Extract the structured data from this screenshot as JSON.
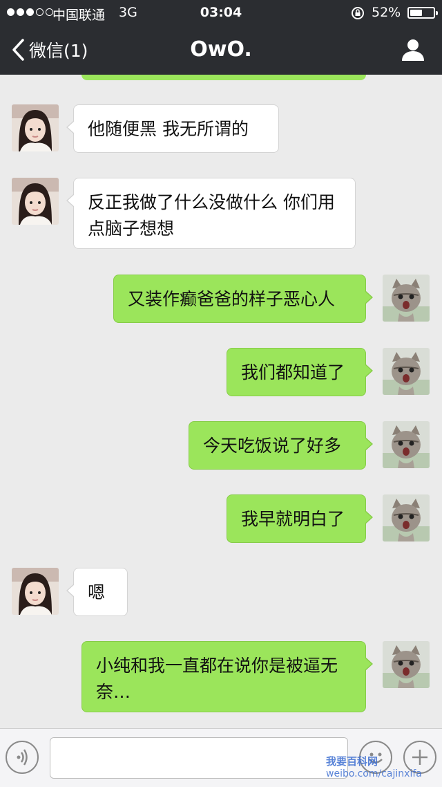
{
  "status_bar": {
    "carrier": "中国联通",
    "network": "3G",
    "time": "03:04",
    "battery": "52%",
    "battery_level": 0.52
  },
  "nav": {
    "back_label": "微信(1)",
    "title": "OwO.",
    "icons": {
      "back": "chevron-left-icon",
      "profile": "person-icon"
    }
  },
  "messages": [
    {
      "side": "in",
      "text": "他随便黑 我无所谓的",
      "avatar": "girl-avatar"
    },
    {
      "side": "in",
      "text": "反正我做了什么没做什么 你们用点脑子想想",
      "avatar": "girl-avatar"
    },
    {
      "side": "out",
      "text": "又装作癫爸爸的样子恶心人",
      "avatar": "kitten-avatar"
    },
    {
      "side": "out",
      "text": "我们都知道了",
      "avatar": "kitten-avatar"
    },
    {
      "side": "out",
      "text": "今天吃饭说了好多",
      "avatar": "kitten-avatar"
    },
    {
      "side": "out",
      "text": "我早就明白了",
      "avatar": "kitten-avatar"
    },
    {
      "side": "in",
      "text": "嗯",
      "avatar": "girl-avatar"
    },
    {
      "side": "out",
      "text": "小纯和我一直都在说你是被逼无奈…",
      "avatar": "kitten-avatar"
    }
  ],
  "input_bar": {
    "text_value": "",
    "icons": {
      "voice": "voice-icon",
      "emoji": "emoji-icon",
      "more": "plus-icon"
    }
  },
  "watermark": {
    "line1": "我要百科网",
    "line2": "weibo.com/cajinxifa"
  },
  "colors": {
    "nav_bg": "#2b2d31",
    "chat_bg": "#ebebeb",
    "outgoing_bubble": "#9be55b",
    "incoming_bubble": "#ffffff"
  }
}
